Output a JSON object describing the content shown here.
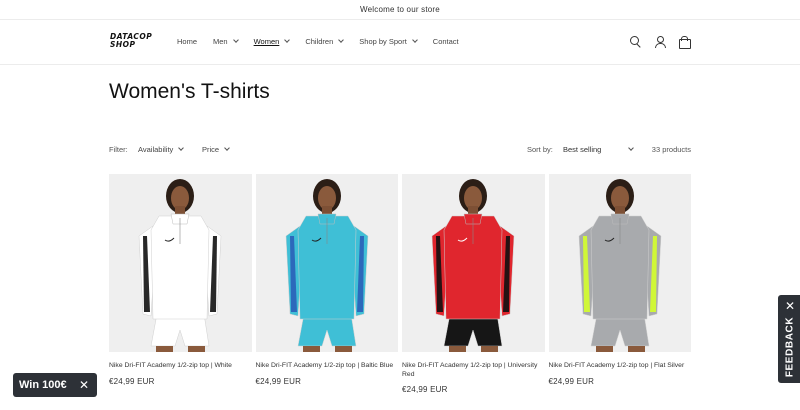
{
  "announcement": "Welcome to our store",
  "logo": {
    "line1": "DATACOP",
    "line2": "SHOP"
  },
  "nav": [
    {
      "label": "Home",
      "dropdown": false,
      "active": false
    },
    {
      "label": "Men",
      "dropdown": true,
      "active": false
    },
    {
      "label": "Women",
      "dropdown": true,
      "active": true
    },
    {
      "label": "Children",
      "dropdown": true,
      "active": false
    },
    {
      "label": "Shop by Sport",
      "dropdown": true,
      "active": false
    },
    {
      "label": "Contact",
      "dropdown": false,
      "active": false
    }
  ],
  "header_icons": [
    "search-icon",
    "account-icon",
    "cart-icon"
  ],
  "page_title": "Women's T-shirts",
  "filters": {
    "label": "Filter:",
    "availability": "Availability",
    "price": "Price",
    "sort_label": "Sort by:",
    "sort_value": "Best selling",
    "count": "33 products"
  },
  "products": [
    {
      "title": "Nike Dri-FIT Academy 1/2-zip top | White",
      "price": "€24,99 EUR",
      "color": "#ffffff",
      "accent": "#111111"
    },
    {
      "title": "Nike Dri-FIT Academy 1/2-zip top | Baltic Blue",
      "price": "€24,99 EUR",
      "color": "#3fbfd6",
      "accent": "#2a5fb8"
    },
    {
      "title": "Nike Dri-FIT Academy 1/2-zip top | University Red",
      "price": "€24,99 EUR",
      "color": "#e0262e",
      "accent": "#111111"
    },
    {
      "title": "Nike Dri-FIT Academy 1/2-zip top | Flat Silver",
      "price": "€24,99 EUR",
      "color": "#a8aaad",
      "accent": "#d4ff2a"
    }
  ],
  "promo": {
    "label": "Win 100€",
    "close": "✕"
  },
  "feedback": {
    "label": "FEEDBACK",
    "close": "✕"
  }
}
